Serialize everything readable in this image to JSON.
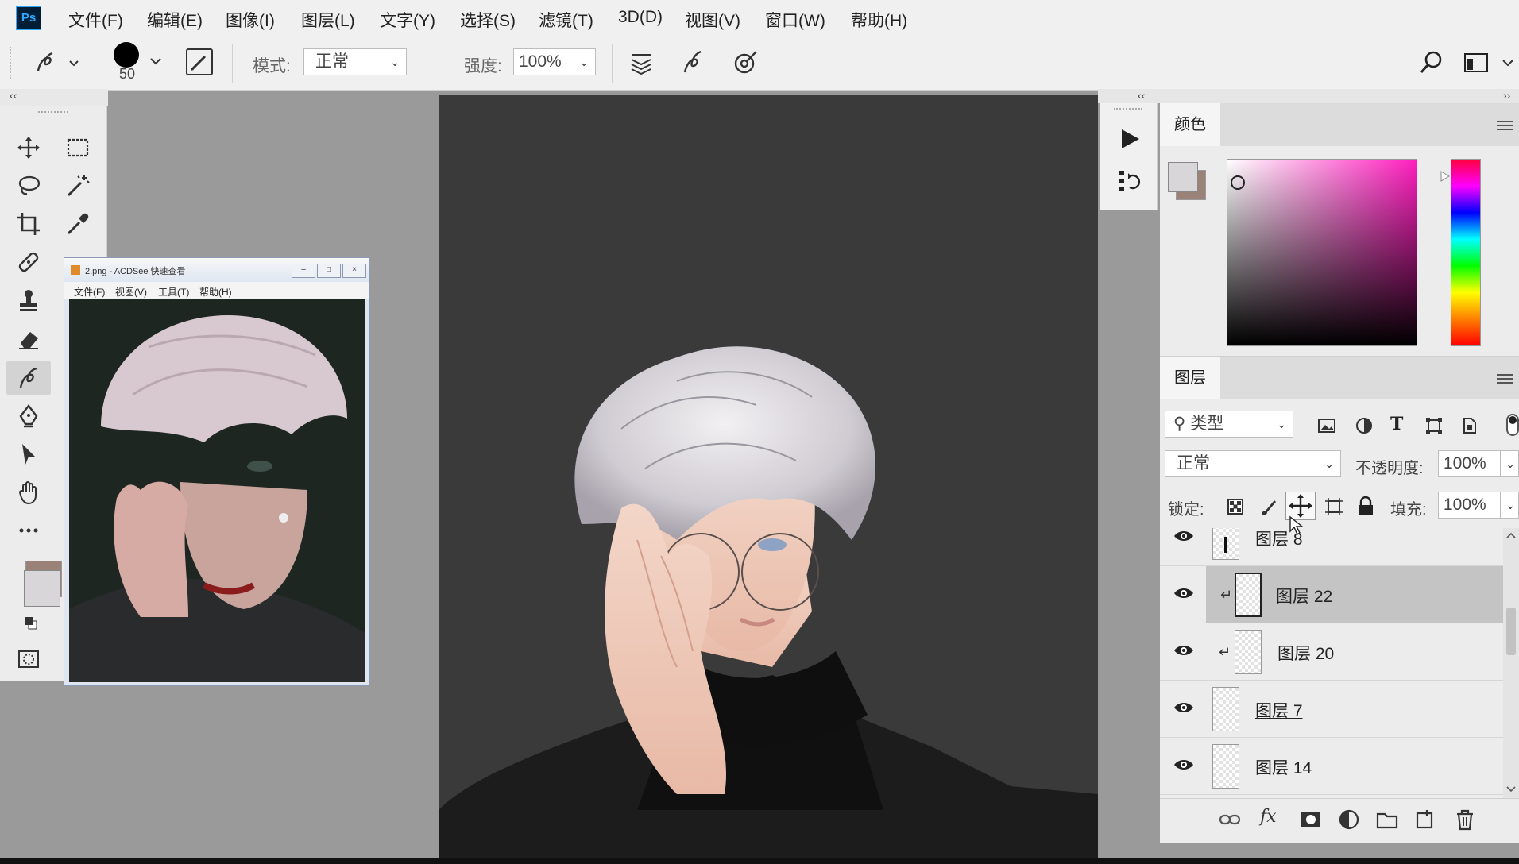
{
  "app": {
    "logo_text": "Ps"
  },
  "menu": [
    "文件(F)",
    "编辑(E)",
    "图像(I)",
    "图层(L)",
    "文字(Y)",
    "选择(S)",
    "滤镜(T)",
    "3D(D)",
    "视图(V)",
    "窗口(W)",
    "帮助(H)"
  ],
  "options": {
    "brush_size": "50",
    "mode_label": "模式:",
    "mode_value": "正常",
    "strength_label": "强度:",
    "strength_value": "100%"
  },
  "colors": {
    "foreground": "#d9d6d9",
    "background": "#9b8279",
    "accent": "#31a8ff"
  },
  "acdsee": {
    "title": "2.png - ACDSee 快速查看",
    "menu": [
      "文件(F)",
      "视图(V)",
      "工具(T)",
      "帮助(H)"
    ]
  },
  "color_panel": {
    "tab": "颜色"
  },
  "layers_panel": {
    "tab": "图层",
    "filter_kind": "类型",
    "blend_mode": "正常",
    "opacity_label": "不透明度:",
    "opacity_value": "100%",
    "lock_label": "锁定:",
    "fill_label": "填充:",
    "fill_value": "100%",
    "layers": [
      {
        "name": "图层 8",
        "selected": false,
        "clipped": false,
        "visible": true
      },
      {
        "name": "图层 22",
        "selected": true,
        "clipped": true,
        "visible": true
      },
      {
        "name": "图层 20",
        "selected": false,
        "clipped": true,
        "visible": true
      },
      {
        "name": "图层 7",
        "selected": false,
        "clipped": false,
        "visible": true
      },
      {
        "name": "图层 14",
        "selected": false,
        "clipped": false,
        "visible": true
      }
    ],
    "bottom_icons": [
      "link-icon",
      "fx-icon",
      "mask-icon",
      "adjustment-icon",
      "folder-icon",
      "new-layer-icon",
      "trash-icon"
    ]
  }
}
